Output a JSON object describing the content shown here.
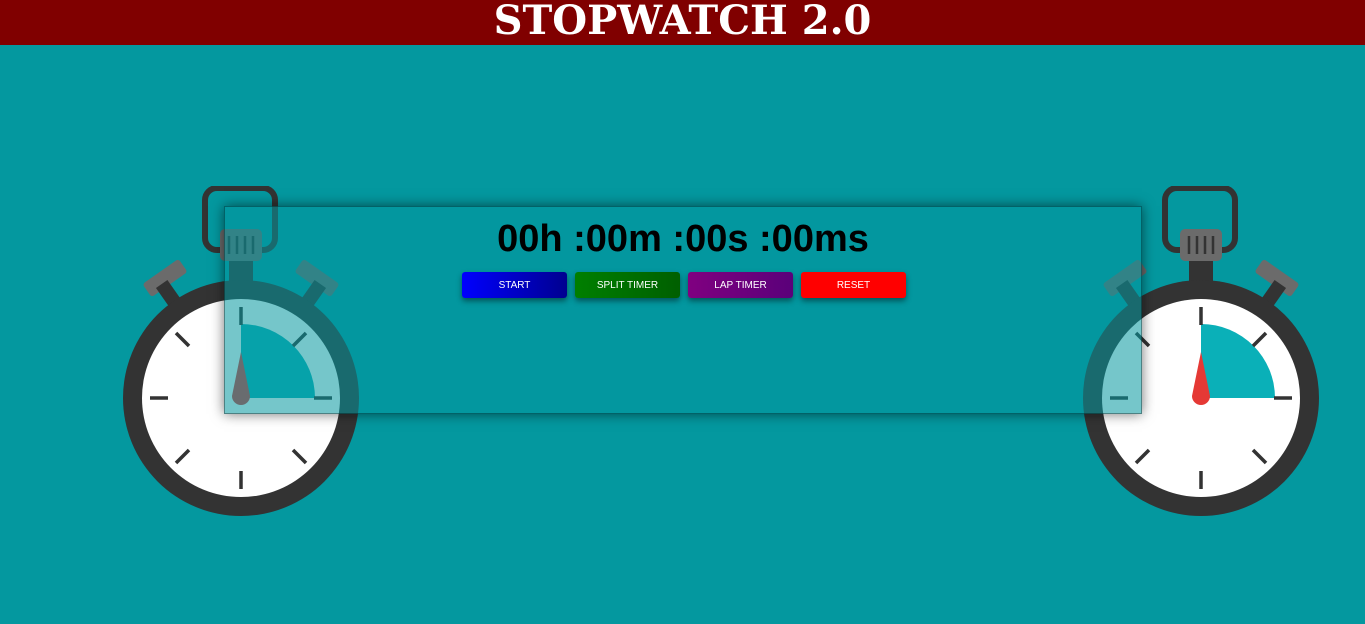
{
  "header": {
    "title": "STOPWATCH 2.0"
  },
  "display": {
    "time": "00h :00m :00s :00ms"
  },
  "buttons": {
    "start": "START",
    "split": "SPLIT TIMER",
    "lap": "LAP TIMER",
    "reset": "RESET"
  },
  "colors": {
    "background": "#04989f",
    "header": "#800000",
    "start": "#0000ff",
    "split": "#007f00",
    "lap": "#800080",
    "reset": "#ff0000"
  },
  "icons": [
    "stopwatch-icon-left",
    "stopwatch-icon-right"
  ]
}
